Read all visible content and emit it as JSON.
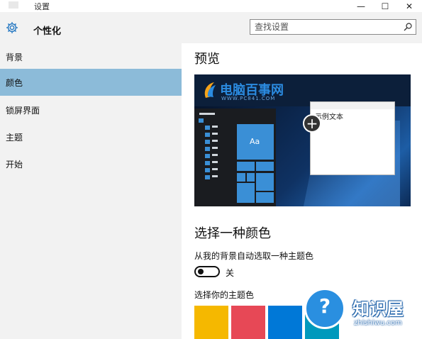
{
  "window": {
    "title": "设置",
    "minimize_glyph": "—",
    "maximize_glyph": "☐",
    "close_glyph": "✕"
  },
  "header": {
    "title": "个性化",
    "icon": "gear-icon",
    "search_placeholder": "查找设置",
    "search_icon": "search-icon"
  },
  "sidebar": {
    "items": [
      {
        "label": "背景",
        "active": false
      },
      {
        "label": "颜色",
        "active": true
      },
      {
        "label": "锁屏界面",
        "active": false
      },
      {
        "label": "主题",
        "active": false
      },
      {
        "label": "开始",
        "active": false
      }
    ],
    "active_color": "#8cbbd9"
  },
  "main": {
    "preview_title": "预览",
    "preview": {
      "tile_text": "Aa",
      "window_text": "示例文本",
      "watermark_text": "电脑百事网",
      "watermark_url": "WWW.PC841.COM",
      "accent": "#3a8fd6"
    },
    "color_title": "选择一种颜色",
    "auto_pick_label": "从我的背景自动选取一种主题色",
    "toggle": {
      "state": "关",
      "on": false
    },
    "pick_label": "选择你的主题色",
    "swatches": [
      "#f5b800",
      "#e74856",
      "#0078d7",
      "#0099bc"
    ]
  },
  "watermark": {
    "text": "知识屋",
    "url": "zhishiwu.com",
    "color": "#2a8fe0"
  }
}
